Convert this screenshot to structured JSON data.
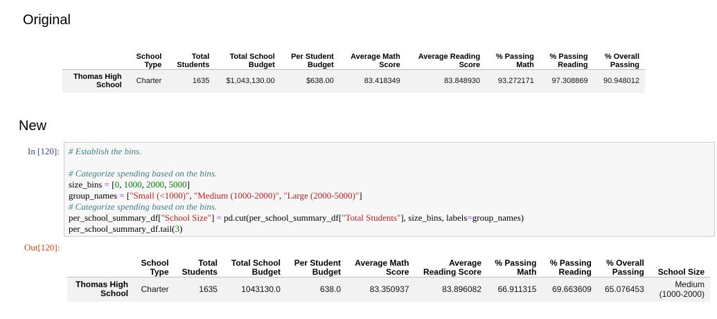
{
  "headings": {
    "original": "Original",
    "new": "New"
  },
  "original_table": {
    "columns": [
      "School Type",
      "Total Students",
      "Total School Budget",
      "Per Student Budget",
      "Average Math Score",
      "Average Reading Score",
      "% Passing Math",
      "% Passing Reading",
      "% Overall Passing"
    ],
    "column_lines": [
      [
        "School",
        "Type"
      ],
      [
        "Total",
        "Students"
      ],
      [
        "Total School",
        "Budget"
      ],
      [
        "Per Student",
        "Budget"
      ],
      [
        "Average Math",
        "Score"
      ],
      [
        "Average Reading",
        "Score"
      ],
      [
        "% Passing",
        "Math"
      ],
      [
        "% Passing",
        "Reading"
      ],
      [
        "% Overall",
        "Passing"
      ]
    ],
    "row": {
      "index_lines": [
        "Thomas High",
        "School"
      ],
      "values": [
        "Charter",
        "1635",
        "$1,043,130.00",
        "$638.00",
        "83.418349",
        "83.848930",
        "93.272171",
        "97.308869",
        "90.948012"
      ]
    }
  },
  "cell": {
    "in_prompt": "In [120]:",
    "out_prompt": "Out[120]:",
    "code": {
      "c1": "# Establish the bins.",
      "c2": "# Categorize spending based on the bins.",
      "l3a": "size_bins ",
      "l3op": "=",
      "l3b": " [",
      "l3n1": "0",
      "l3s1": ", ",
      "l3n2": "1000",
      "l3s2": ", ",
      "l3n3": "2000",
      "l3s3": ", ",
      "l3n4": "5000",
      "l3c": "]",
      "l4a": "group_names ",
      "l4op": "=",
      "l4b": " [",
      "l4s1": "\"Small (<1000)\"",
      "l4c1": ", ",
      "l4s2": "\"Medium (1000-2000)\"",
      "l4c2": ", ",
      "l4s3": "\"Large (2000-5000)\"",
      "l4c": "]",
      "c3": "# Categorize spending based on the bins.",
      "l6a": "per_school_summary_df[",
      "l6s1": "\"School Size\"",
      "l6b": "] ",
      "l6op": "=",
      "l6c": " pd.cut(per_school_summary_df[",
      "l6s2": "\"Total Students\"",
      "l6d": "], size_bins, labels",
      "l6op2": "=",
      "l6e": "group_names)",
      "l7a": "per_school_summary_df.tail(",
      "l7n": "3",
      "l7b": ")"
    }
  },
  "new_table": {
    "columns": [
      "School Type",
      "Total Students",
      "Total School Budget",
      "Per Student Budget",
      "Average Math Score",
      "Average Reading Score",
      "% Passing Math",
      "% Passing Reading",
      "% Overall Passing",
      "School Size"
    ],
    "column_lines": [
      [
        "School",
        "Type"
      ],
      [
        "Total",
        "Students"
      ],
      [
        "Total School",
        "Budget"
      ],
      [
        "Per Student",
        "Budget"
      ],
      [
        "Average Math",
        "Score"
      ],
      [
        "Average",
        "Reading Score"
      ],
      [
        "% Passing",
        "Math"
      ],
      [
        "% Passing",
        "Reading"
      ],
      [
        "% Overall",
        "Passing"
      ],
      [
        "School Size"
      ]
    ],
    "row": {
      "index_lines": [
        "Thomas High",
        "School"
      ],
      "values": [
        "Charter",
        "1635",
        "1043130.0",
        "638.0",
        "83.350937",
        "83.896082",
        "66.911315",
        "69.663609",
        "65.076453"
      ],
      "school_size_lines": [
        "Medium",
        "(1000-2000)"
      ]
    }
  }
}
